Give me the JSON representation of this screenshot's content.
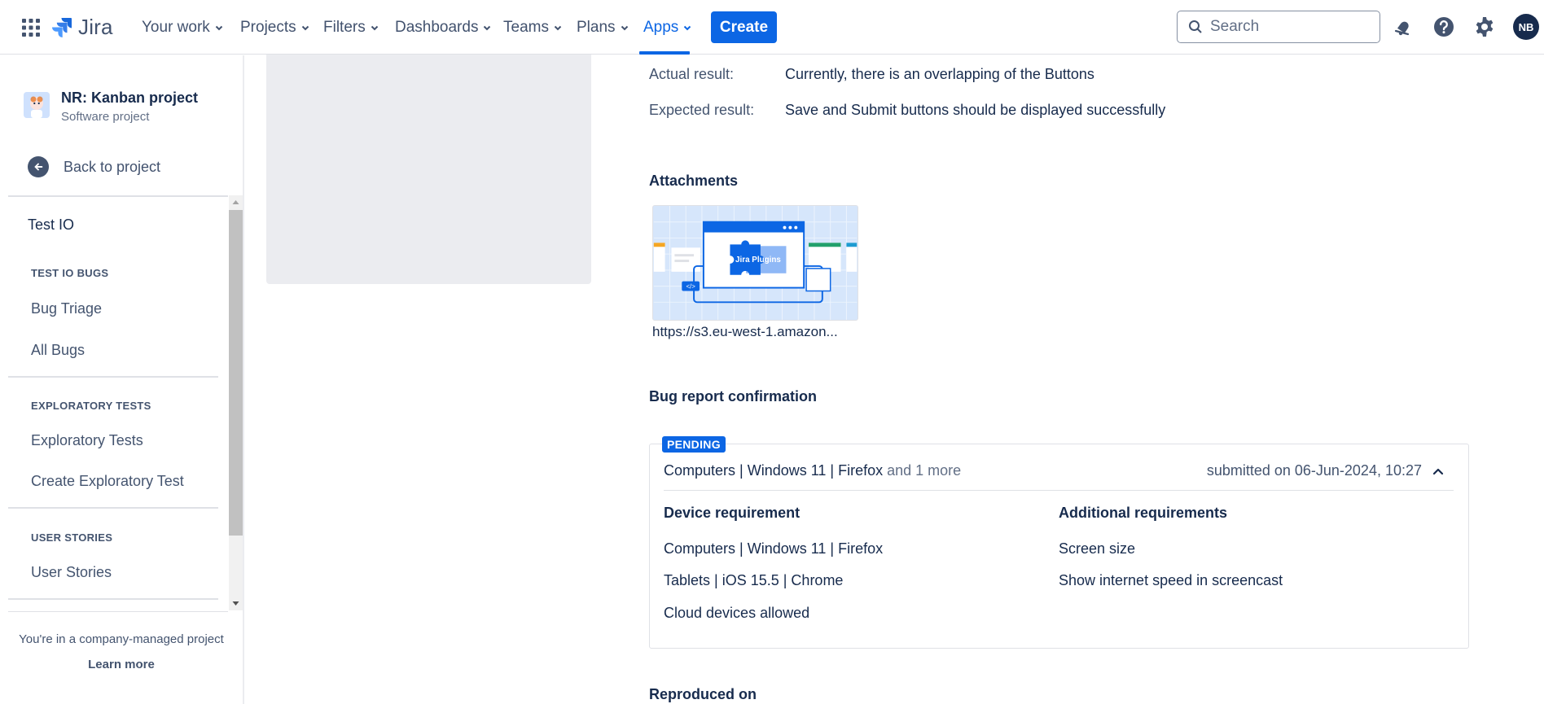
{
  "topnav": {
    "app_name": "Jira",
    "items": [
      {
        "label": "Your work"
      },
      {
        "label": "Projects"
      },
      {
        "label": "Filters"
      },
      {
        "label": "Dashboards"
      },
      {
        "label": "Teams"
      },
      {
        "label": "Plans"
      },
      {
        "label": "Apps",
        "active": true
      }
    ],
    "create_label": "Create",
    "search_placeholder": "Search",
    "avatar_initials": "NB",
    "accent_color": "#0c66e4"
  },
  "sidebar": {
    "project_name": "NR: Kanban project",
    "project_type": "Software project",
    "back_label": "Back to project",
    "menu_title": "Test IO",
    "sections": [
      {
        "heading": "TEST IO BUGS",
        "items": [
          "Bug Triage",
          "All Bugs"
        ]
      },
      {
        "heading": "EXPLORATORY TESTS",
        "items": [
          "Exploratory Tests",
          "Create Exploratory Test"
        ]
      },
      {
        "heading": "USER STORIES",
        "items": [
          "User Stories"
        ]
      }
    ],
    "footer_text": "You're in a company-managed project",
    "footer_link": "Learn more"
  },
  "main": {
    "fields": [
      {
        "label": "Actual result:",
        "value": "Currently, there is an overlapping of the Buttons"
      },
      {
        "label": "Expected result:",
        "value": "Save and Submit buttons should be displayed successfully"
      }
    ],
    "attachments_title": "Attachments",
    "attachment": {
      "thumb_text": "Jira Plugins",
      "name": "https://s3.eu-west-1.amazon..."
    },
    "confirmation_title": "Bug report confirmation",
    "confirmation": {
      "status": "PENDING",
      "device_summary": "Computers | Windows 11 | Firefox",
      "device_more": "and 1 more",
      "submitted": "submitted on 06-Jun-2024, 10:27",
      "device_req_heading": "Device requirement",
      "device_reqs": [
        "Computers | Windows 11 | Firefox",
        "Tablets | iOS 15.5 | Chrome",
        "Cloud devices allowed"
      ],
      "additional_heading": "Additional requirements",
      "additional_reqs": [
        "Screen size",
        "Show internet speed in screencast"
      ]
    },
    "reproduced_title": "Reproduced on"
  }
}
